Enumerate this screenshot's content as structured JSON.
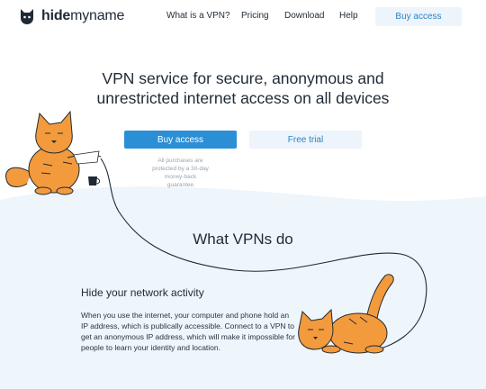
{
  "header": {
    "logo": {
      "bold": "hide",
      "light": "myname"
    },
    "nav": [
      {
        "label": "What is a VPN?"
      },
      {
        "label": "Pricing"
      },
      {
        "label": "Download"
      },
      {
        "label": "Help"
      }
    ],
    "buy_label": "Buy access"
  },
  "hero": {
    "title_line1": "VPN service for secure, anonymous and",
    "title_line2": "unrestricted internet access on all devices",
    "primary_button": "Buy access",
    "secondary_button": "Free trial",
    "guarantee": "All purchases are protected by a 30-day money-back guarantee"
  },
  "section": {
    "title": "What VPNs do",
    "feature_title": "Hide your network activity",
    "feature_text": "When you use the internet, your computer and phone hold an IP address, which is publically accessible. Connect to a VPN to get an anonymous IP address, which will make it impossible for people to learn your identity and location."
  },
  "colors": {
    "accent": "#2b8fd6",
    "light_accent": "#edf4fb",
    "section_bg": "#eef5fb",
    "cat_orange": "#f39a3d",
    "text": "#1f2a35"
  },
  "icons": {
    "logo": "cat-head-icon"
  }
}
